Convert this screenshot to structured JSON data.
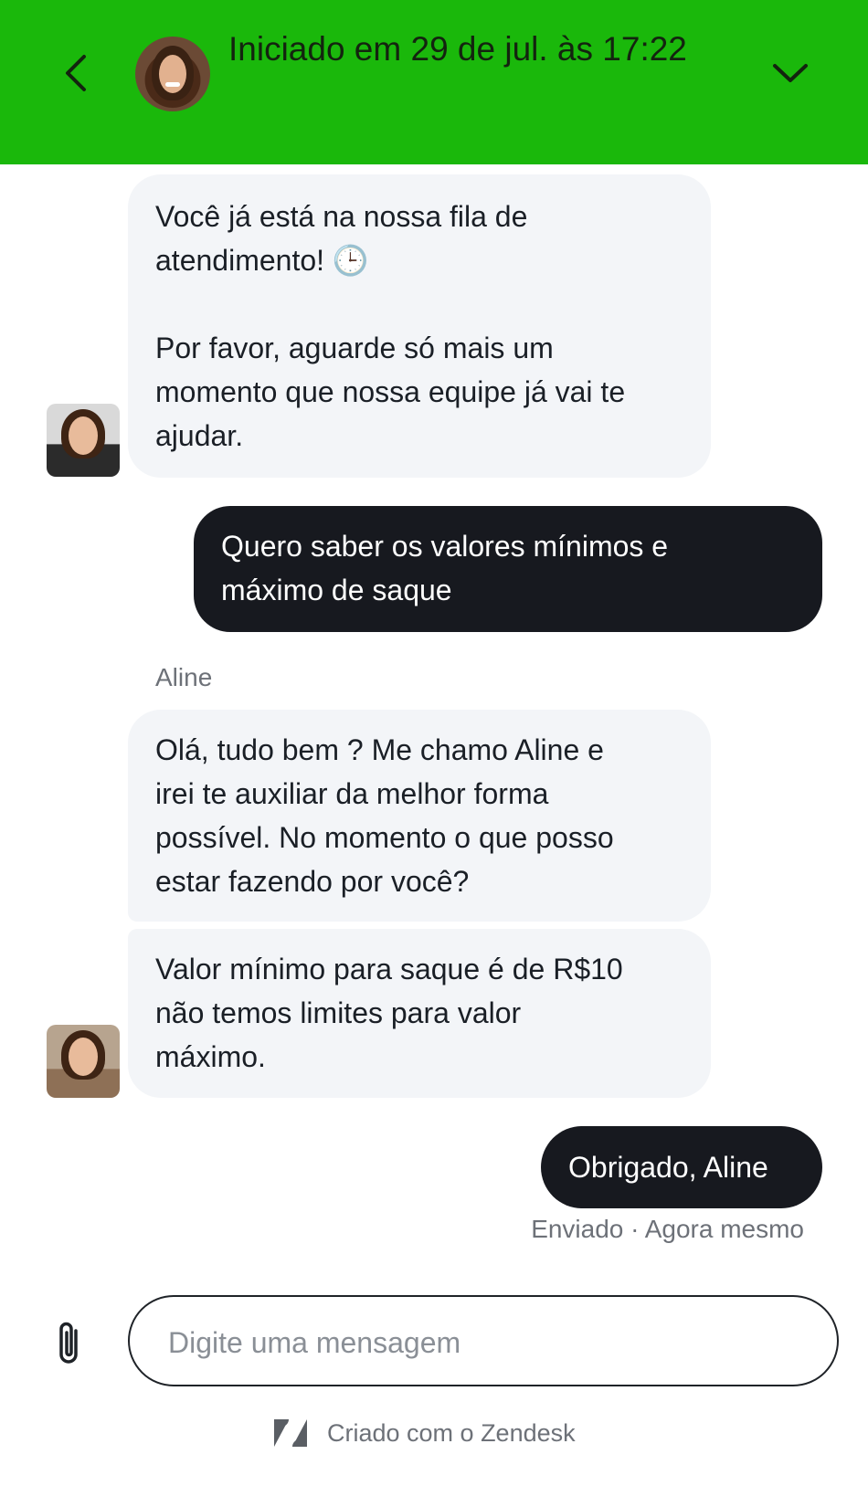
{
  "header": {
    "title": "Iniciado em 29 de jul. às 17:22",
    "background": "#1ab80b"
  },
  "messages": {
    "m1": {
      "text": "Você já está na nossa fila de\natendimento! 🕒\n\nPor favor, aguarde só mais um\nmomento que nossa equipe já vai te\najudar.",
      "direction": "incoming"
    },
    "m2": {
      "text": "Quero saber os valores mínimos e\nmáximo de saque",
      "direction": "outgoing"
    },
    "sender_name": "Aline",
    "m3": {
      "text": "Olá, tudo bem ? Me chamo Aline e\nirei te auxiliar da melhor forma\npossível. No momento o que posso\nestar fazendo por você?",
      "direction": "incoming"
    },
    "m4": {
      "text": "Valor mínimo para saque é de R$10\nnão temos limites para valor\nmáximo.",
      "direction": "incoming"
    },
    "m5": {
      "text": "Obrigado, Aline",
      "direction": "outgoing"
    },
    "status": "Enviado · Agora mesmo"
  },
  "composer": {
    "placeholder": "Digite uma mensagem",
    "value": ""
  },
  "footer": {
    "text": "Criado com o Zendesk"
  },
  "icons": {
    "back": "chevron-left-icon",
    "collapse": "chevron-down-icon",
    "attach": "paperclip-icon",
    "brand": "zendesk-logo-icon"
  },
  "colors": {
    "header_green": "#1ab80b",
    "incoming_bubble": "#f3f5f8",
    "outgoing_bubble": "#17191f"
  }
}
